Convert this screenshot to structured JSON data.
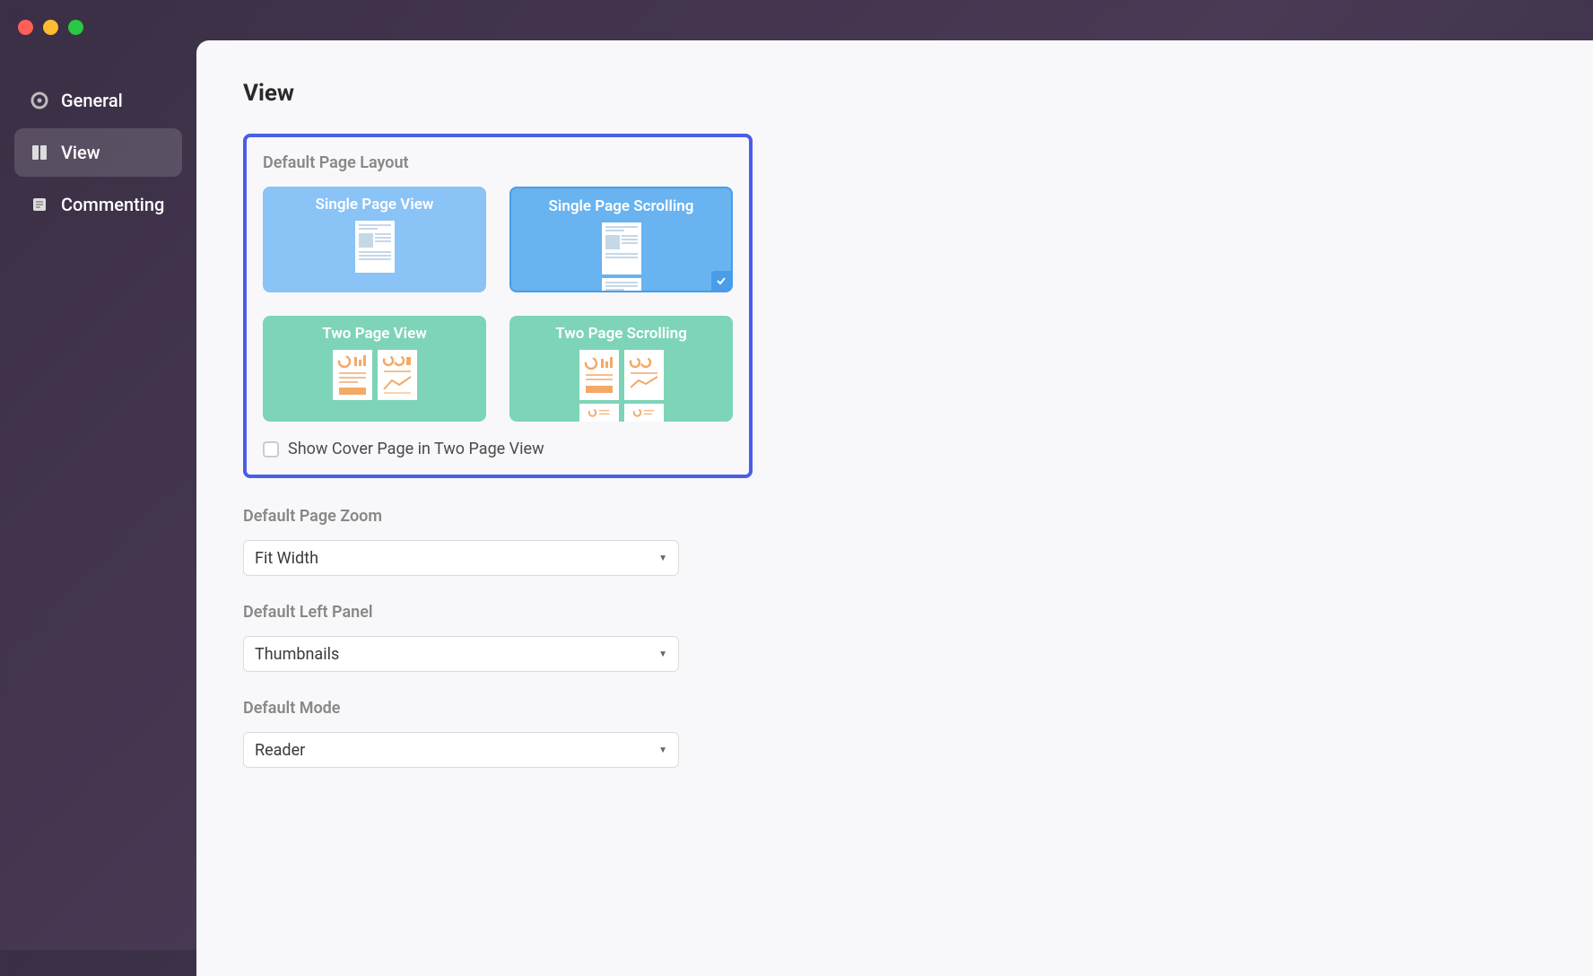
{
  "sidebar": {
    "items": [
      {
        "label": "General",
        "icon": "circle"
      },
      {
        "label": "View",
        "icon": "layout"
      },
      {
        "label": "Commenting",
        "icon": "note"
      }
    ]
  },
  "page": {
    "title": "View",
    "layout_section": {
      "label": "Default Page Layout",
      "options": [
        {
          "label": "Single Page View"
        },
        {
          "label": "Single Page Scrolling"
        },
        {
          "label": "Two Page View"
        },
        {
          "label": "Two Page Scrolling"
        }
      ],
      "cover_checkbox_label": "Show Cover Page in Two Page View"
    },
    "zoom_section": {
      "label": "Default Page Zoom",
      "value": "Fit Width"
    },
    "left_panel_section": {
      "label": "Default Left Panel",
      "value": "Thumbnails"
    },
    "mode_section": {
      "label": "Default Mode",
      "value": "Reader"
    }
  }
}
